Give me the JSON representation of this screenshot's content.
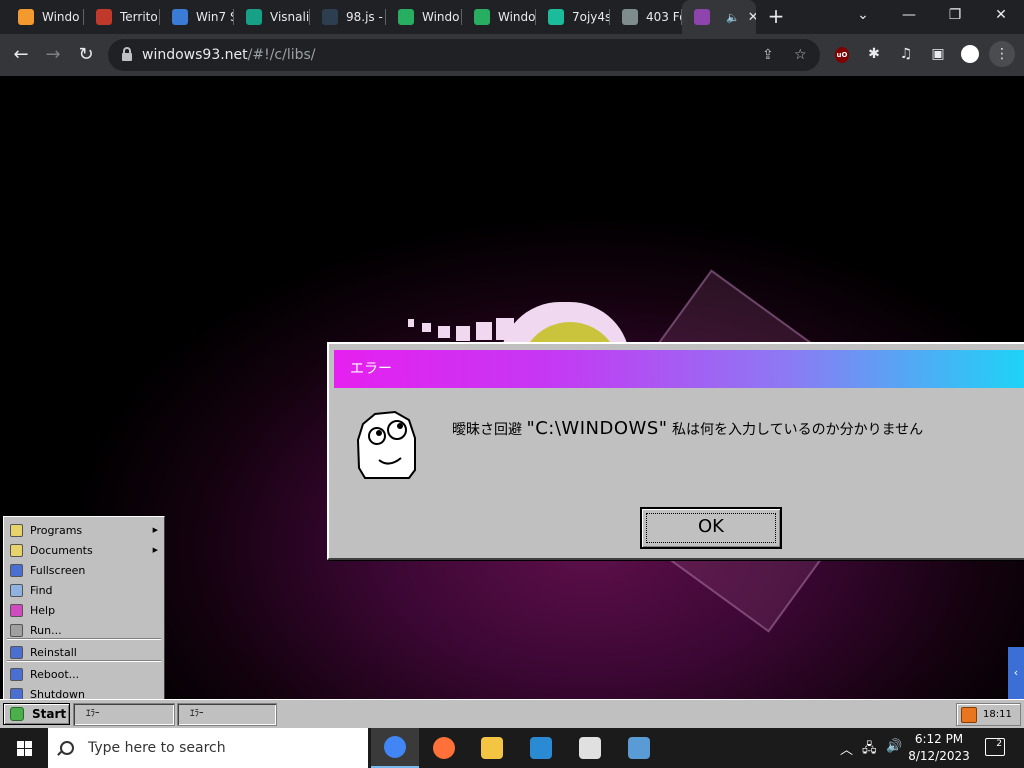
{
  "browser": {
    "tabs": [
      {
        "title": "Windo",
        "icon": "page-favicon",
        "color": "#f29a2e",
        "active": false
      },
      {
        "title": "Territo",
        "icon": "flag-favicon",
        "color": "#c0392b",
        "active": false
      },
      {
        "title": "Win7 S",
        "icon": "windows-favicon",
        "color": "#3a7bd5",
        "active": false
      },
      {
        "title": "Visnali",
        "icon": "u-favicon",
        "color": "#16a085",
        "active": false
      },
      {
        "title": "98.js -",
        "icon": "98js-favicon",
        "color": "#2c3e50",
        "active": false
      },
      {
        "title": "Windo",
        "icon": "spreadsheet-favicon",
        "color": "#27ae60",
        "active": false
      },
      {
        "title": "Windo",
        "icon": "spreadsheet-favicon",
        "color": "#27ae60",
        "active": false
      },
      {
        "title": "7ojy4s",
        "icon": "circles-favicon",
        "color": "#1abc9c",
        "active": false
      },
      {
        "title": "403 Fo",
        "icon": "globe-favicon",
        "color": "#7f8c8d",
        "active": false
      },
      {
        "title": "",
        "icon": "windows93-favicon",
        "color": "#8e44ad",
        "active": true
      }
    ],
    "new_tab_symbol": "+",
    "window_controls": {
      "tab_search": "⌄",
      "minimize": "—",
      "restore": "❐",
      "close": "✕"
    },
    "nav": {
      "back": "←",
      "forward": "→",
      "reload": "↻"
    },
    "url_host": "windows93.net",
    "url_rest": "/#!/c/libs/"
  },
  "dialog": {
    "title": "エラー",
    "message_prefix": "曖昧さ回避",
    "message_path": "\"C:\\WINDOWS\"",
    "message_suffix": "私は何を入力しているのか分かりません",
    "ok_label": "OK"
  },
  "start_menu": {
    "items": [
      {
        "label": "Programs",
        "icon": "programs-icon",
        "color": "#e6d36a",
        "submenu": true
      },
      {
        "label": "Documents",
        "icon": "documents-icon",
        "color": "#e6d36a",
        "submenu": true
      },
      {
        "label": "Fullscreen",
        "icon": "fullscreen-icon",
        "color": "#4a6fd0",
        "submenu": false
      },
      {
        "label": "Find",
        "icon": "find-icon",
        "color": "#8fb2e0",
        "submenu": false
      },
      {
        "label": "Help",
        "icon": "help-icon",
        "color": "#d04ac0",
        "submenu": false
      },
      {
        "label": "Run...",
        "icon": "run-icon",
        "color": "#a0a0a0",
        "submenu": false
      },
      {
        "label": "Reinstall",
        "icon": "reinstall-icon",
        "color": "#4a6fd0",
        "submenu": false
      },
      {
        "label": "Reboot...",
        "icon": "reboot-icon",
        "color": "#4a6fd0",
        "submenu": false
      },
      {
        "label": "Shutdown",
        "icon": "shutdown-icon",
        "color": "#4a6fd0",
        "submenu": false
      }
    ]
  },
  "w93_taskbar": {
    "start_label": "Start",
    "tasks": [
      "ｴﾗｰ",
      "ｴﾗｰ"
    ],
    "tray_time": "18:11"
  },
  "win_taskbar": {
    "search_placeholder": "Type here to search",
    "apps": [
      {
        "name": "chrome",
        "color": "#4285f4",
        "active": true
      },
      {
        "name": "firefox",
        "color": "#ff7139",
        "active": false
      },
      {
        "name": "file-explorer",
        "color": "#f4c542",
        "active": false
      },
      {
        "name": "microsoft-store",
        "color": "#2a8ad4",
        "active": false
      },
      {
        "name": "calculator",
        "color": "#e0e0e0",
        "active": false
      },
      {
        "name": "remote-desktop",
        "color": "#5b9bd5",
        "active": false
      }
    ],
    "time": "6:12 PM",
    "date": "8/12/2023",
    "notification_count": "2"
  }
}
